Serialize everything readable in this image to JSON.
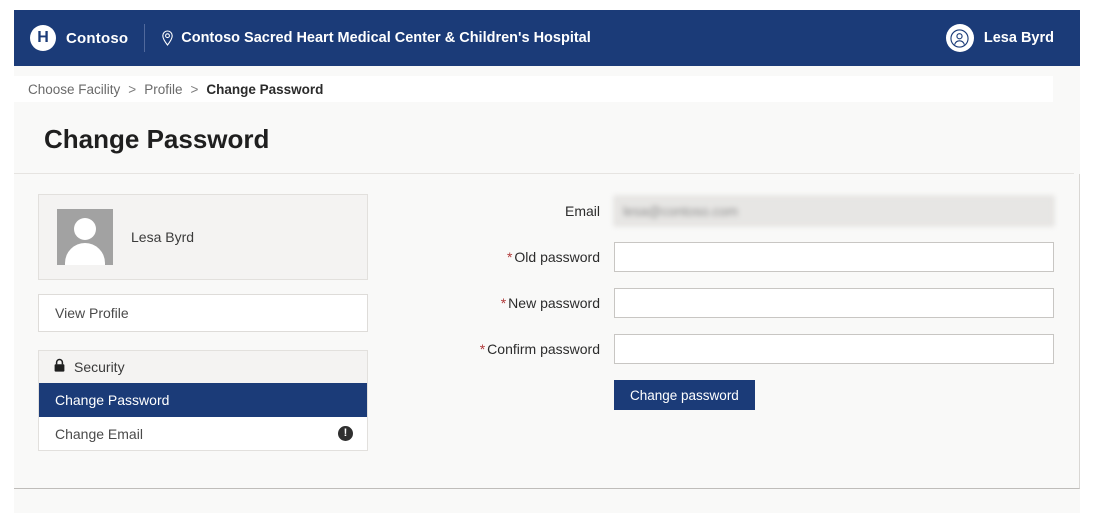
{
  "topbar": {
    "logo_letter": "H",
    "brand": "Contoso",
    "pin_icon": "location-pin-icon",
    "facility": "Contoso Sacred Heart Medical Center & Children's Hospital",
    "user": "Lesa Byrd",
    "user_icon": "person-icon",
    "background_color": "#1b3b78"
  },
  "breadcrumb": {
    "items": [
      {
        "label": "Choose Facility",
        "current": false
      },
      {
        "label": "Profile",
        "current": false
      },
      {
        "label": "Change Password",
        "current": true
      }
    ],
    "separator": ">"
  },
  "page": {
    "title": "Change Password"
  },
  "sidebar": {
    "profile": {
      "name": "Lesa Byrd",
      "avatar_icon": "user-placeholder-avatar"
    },
    "view_profile_label": "View Profile",
    "security_group": {
      "icon": "lock-icon",
      "label": "Security",
      "items": [
        {
          "label": "Change Password",
          "active": true,
          "badge": ""
        },
        {
          "label": "Change Email",
          "active": false,
          "badge": "!"
        }
      ]
    }
  },
  "form": {
    "fields": [
      {
        "label": "Email",
        "required": false,
        "value": "lesa@contoso.com",
        "placeholder": "",
        "disabled": true,
        "type": "text"
      },
      {
        "label": "Old password",
        "required": true,
        "value": "",
        "placeholder": "",
        "disabled": false,
        "type": "password"
      },
      {
        "label": "New password",
        "required": true,
        "value": "",
        "placeholder": "",
        "disabled": false,
        "type": "password"
      },
      {
        "label": "Confirm password",
        "required": true,
        "value": "",
        "placeholder": "",
        "disabled": false,
        "type": "password"
      }
    ],
    "submit_label": "Change password",
    "required_marker": "*"
  },
  "colors": {
    "brand_navy": "#1b3b78",
    "required_red": "#b03a3a",
    "page_background": "#f9f9f8"
  }
}
